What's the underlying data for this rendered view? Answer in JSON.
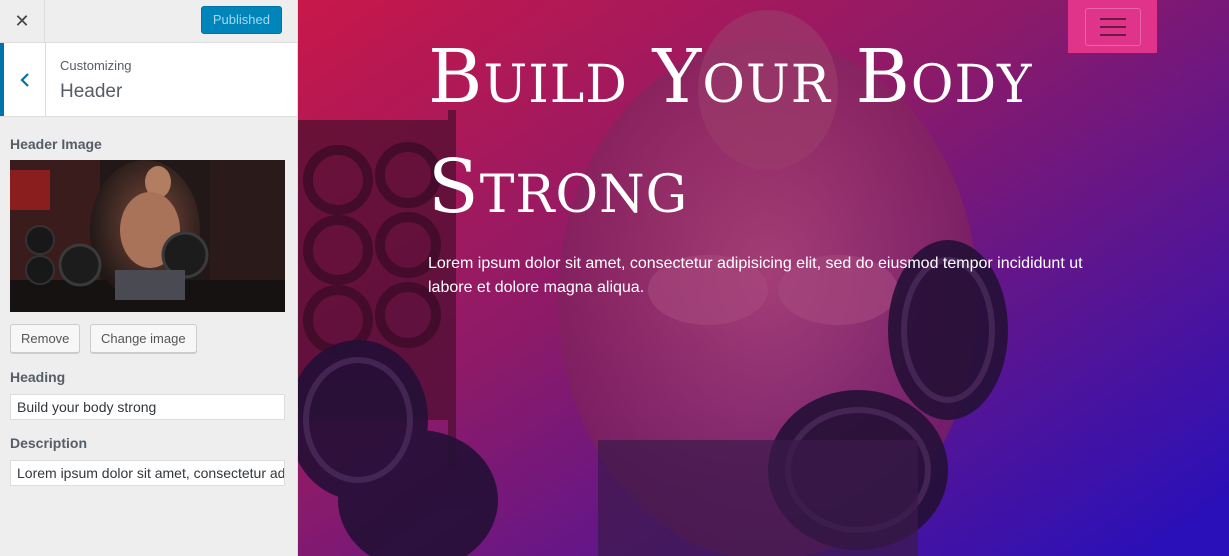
{
  "topbar": {
    "close_icon": "close-icon",
    "publish_label": "Published"
  },
  "section": {
    "crumb": "Customizing",
    "title": "Header",
    "back_icon": "chevron-left-icon"
  },
  "controls": {
    "header_image_label": "Header Image",
    "remove_label": "Remove",
    "change_image_label": "Change image",
    "heading_label": "Heading",
    "heading_value": "Build your body strong",
    "description_label": "Description",
    "description_value": "Lorem ipsum dolor sit amet, consectetur adipisicing elit"
  },
  "preview": {
    "hero_title": "Build your body strong",
    "hero_description": "Lorem ipsum dolor sit amet, consectetur adipisicing elit, sed do eiusmod tempor incididunt ut labore et dolore magna aliqua.",
    "menu_icon": "hamburger-menu-icon"
  },
  "colors": {
    "accent": "#0085ba",
    "menu_bg": "#e0338a",
    "gradient_start": "#c21e55",
    "gradient_end": "#3a12b8"
  }
}
